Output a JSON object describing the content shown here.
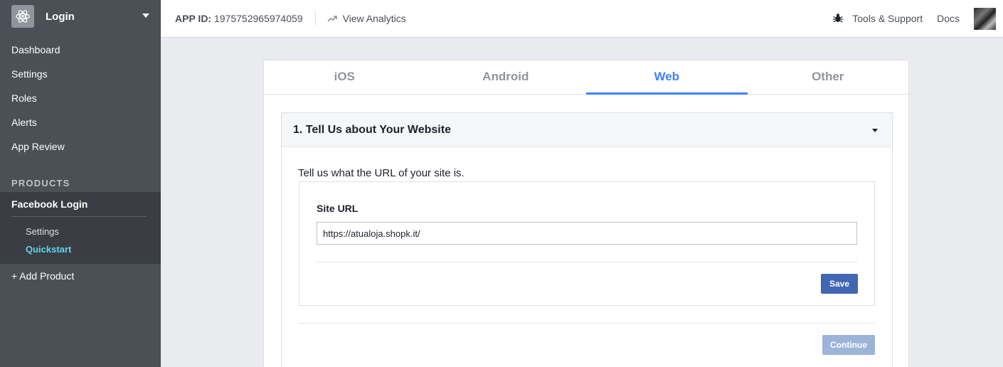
{
  "sidebar": {
    "app_name": "Login",
    "nav": [
      "Dashboard",
      "Settings",
      "Roles",
      "Alerts",
      "App Review"
    ],
    "products_title": "PRODUCTS",
    "product_name": "Facebook Login",
    "product_sub": [
      "Settings",
      "Quickstart"
    ],
    "add_product": "+ Add Product"
  },
  "topbar": {
    "app_id_label": "APP ID:",
    "app_id_value": "1975752965974059",
    "analytics": "View Analytics",
    "tools": "Tools & Support",
    "docs": "Docs"
  },
  "tabs": [
    "iOS",
    "Android",
    "Web",
    "Other"
  ],
  "active_tab": "Web",
  "step": {
    "title": "1. Tell Us about Your Website",
    "description": "Tell us what the URL of your site is.",
    "field_label": "Site URL",
    "field_value": "https://atualoja.shopk.it/",
    "save_label": "Save",
    "continue_label": "Continue"
  },
  "colors": {
    "sidebar_bg": "#4b4f56",
    "active_tab": "#4080ff",
    "quickstart_active": "#5cd6f1",
    "save_button": "#4267b2",
    "continue_disabled": "#9cb4d8"
  }
}
